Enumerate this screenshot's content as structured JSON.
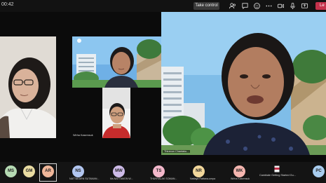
{
  "toolbar": {
    "timer": "00:42",
    "take_control_label": "Take control",
    "leave_label": "Le",
    "icons": [
      "people-icon",
      "chat-icon",
      "reactions-icon",
      "more-icon",
      "camera-icon",
      "mic-icon",
      "share-icon"
    ]
  },
  "tiles": {
    "top_name": "",
    "mid_name": "Wirha Kasemsuk",
    "big_name": "Thiranun Chantaku..."
  },
  "participants": [
    {
      "initials": "MS",
      "name": "",
      "color": "#b6dbb4"
    },
    {
      "initials": "GM",
      "name": "",
      "color": "#e9dca2"
    },
    {
      "initials": "AR",
      "name": "",
      "color": "#f0b79a"
    },
    {
      "initials": "NS",
      "name": "NATTAKARN SUTAMAN...",
      "color": "#b2c6f0"
    },
    {
      "initials": "MW",
      "name": "Ms.NATTAMON W...",
      "color": "#cdbbe8"
    },
    {
      "initials": "TS",
      "name": "THUNYALAK SOMAN...",
      "color": "#f3b8cb"
    },
    {
      "initials": "NR",
      "name": "Nattaya Rattana-umpa",
      "color": "#f2d79b"
    },
    {
      "initials": "WK",
      "name": "Wirha Kasemsuk",
      "color": "#f5b6b0"
    },
    {
      "initials": "PC",
      "name": "",
      "color": "#a9cdef"
    }
  ],
  "share": {
    "label": "Cambiale Getting Started Gu..."
  }
}
